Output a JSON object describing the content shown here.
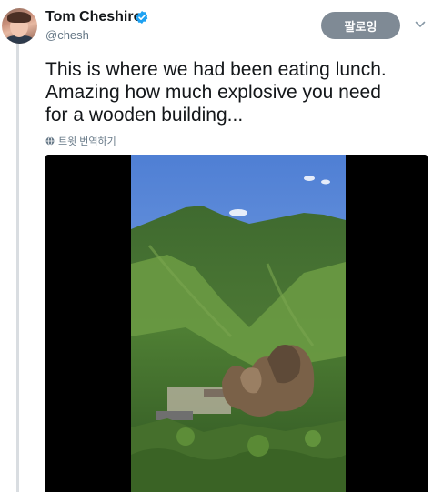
{
  "author": {
    "name": "Tom Cheshire",
    "handle": "@chesh",
    "verified": true
  },
  "follow_button": {
    "label": "팔로잉"
  },
  "tweet": {
    "text": "This is where we had been eating lunch.\nAmazing how much explosive you need\nfor a wooden building...",
    "translate_label": "트윗 번역하기"
  },
  "icons": {
    "verified": "verified-badge-icon",
    "menu": "chevron-down-icon",
    "translate": "globe-icon"
  },
  "colors": {
    "follow_button_bg": "#7f8a95",
    "verified_blue": "#1da1f2",
    "secondary_text": "#657786"
  }
}
